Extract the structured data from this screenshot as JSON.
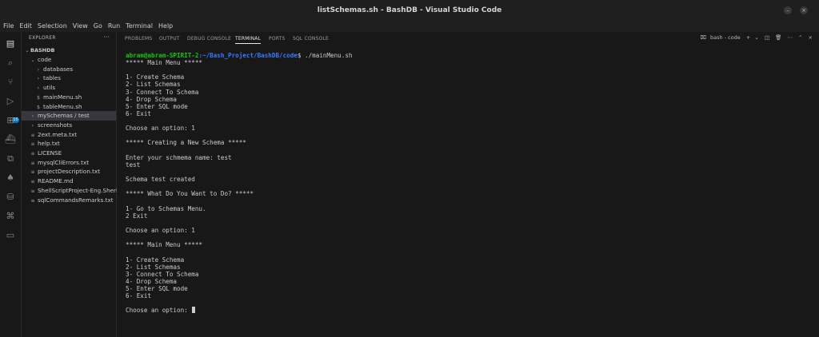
{
  "window": {
    "title": "listSchemas.sh - BashDB - Visual Studio Code"
  },
  "menubar": [
    "File",
    "Edit",
    "Selection",
    "View",
    "Go",
    "Run",
    "Terminal",
    "Help"
  ],
  "activity_bar": {
    "icons": [
      "files-icon",
      "search-icon",
      "source-control-icon",
      "run-debug-icon",
      "extensions-icon",
      "docker-icon",
      "remote-explorer-icon",
      "mongodb-icon",
      "database-icon",
      "python-icon",
      "comments-icon"
    ],
    "source_control_badge": "10"
  },
  "explorer": {
    "header": "EXPLORER",
    "more": "···",
    "root": "BASHDB",
    "items": [
      {
        "label": "code",
        "kind": "folder-open",
        "depth": 1
      },
      {
        "label": "databases",
        "kind": "folder",
        "depth": 2
      },
      {
        "label": "tables",
        "kind": "folder",
        "depth": 2
      },
      {
        "label": "utils",
        "kind": "folder",
        "depth": 2
      },
      {
        "label": "mainMenu.sh",
        "kind": "file",
        "depth": 2
      },
      {
        "label": "tableMenu.sh",
        "kind": "file",
        "depth": 2
      },
      {
        "label": "mySchemas / test",
        "kind": "folder",
        "depth": 1,
        "selected": true
      },
      {
        "label": "screenshots",
        "kind": "folder",
        "depth": 1
      },
      {
        "label": "2ext.meta.txt",
        "kind": "file",
        "depth": 1
      },
      {
        "label": "help.txt",
        "kind": "file",
        "depth": 1
      },
      {
        "label": "LICENSE",
        "kind": "file",
        "depth": 1
      },
      {
        "label": "mysqlCliErrors.txt",
        "kind": "file",
        "depth": 1
      },
      {
        "label": "projectDescription.txt",
        "kind": "file",
        "depth": 1
      },
      {
        "label": "README.md",
        "kind": "file",
        "depth": 1
      },
      {
        "label": "ShellScriptProject-Eng.Sherie...",
        "kind": "file",
        "depth": 1
      },
      {
        "label": "sqlCommandsRemarks.txt",
        "kind": "file",
        "depth": 1
      }
    ]
  },
  "panel": {
    "tabs": [
      "PROBLEMS",
      "OUTPUT",
      "DEBUG CONSOLE",
      "TERMINAL",
      "PORTS",
      "SQL CONSOLE"
    ],
    "active_tab": "TERMINAL",
    "actions": {
      "terminal_name": "bash - code",
      "add": "+",
      "dropdown": "⌄"
    }
  },
  "terminal": {
    "prompt_user": "abram@abram-SPIRIT-2",
    "prompt_path": ":~/Bash_Project/BashDB/code",
    "prompt_cmd": "$ ./mainMenu.sh",
    "lines": [
      "***** Main Menu *****",
      "",
      "1- Create Schema",
      "2- List Schemas",
      "3- Connect To Schema",
      "4- Drop Schema",
      "5- Enter SQL mode",
      "6- Exit",
      "",
      "Choose an option: 1",
      "",
      "***** Creating a New Schema *****",
      "",
      "Enter your schmema name: test",
      "test",
      "",
      "Schema test created",
      "",
      "***** What Do You Want to Do? *****",
      "",
      "1- Go to Schemas Menu.",
      "2 Exit",
      "",
      "Choose an option: 1",
      "",
      "***** Main Menu *****",
      "",
      "1- Create Schema",
      "2- List Schemas",
      "3- Connect To Schema",
      "4- Drop Schema",
      "5- Enter SQL mode",
      "6- Exit",
      "",
      "Choose an option: "
    ]
  },
  "colors": {
    "prompt_user": "#16c60c",
    "prompt_path": "#3b78ff",
    "accent": "#0078d4"
  }
}
